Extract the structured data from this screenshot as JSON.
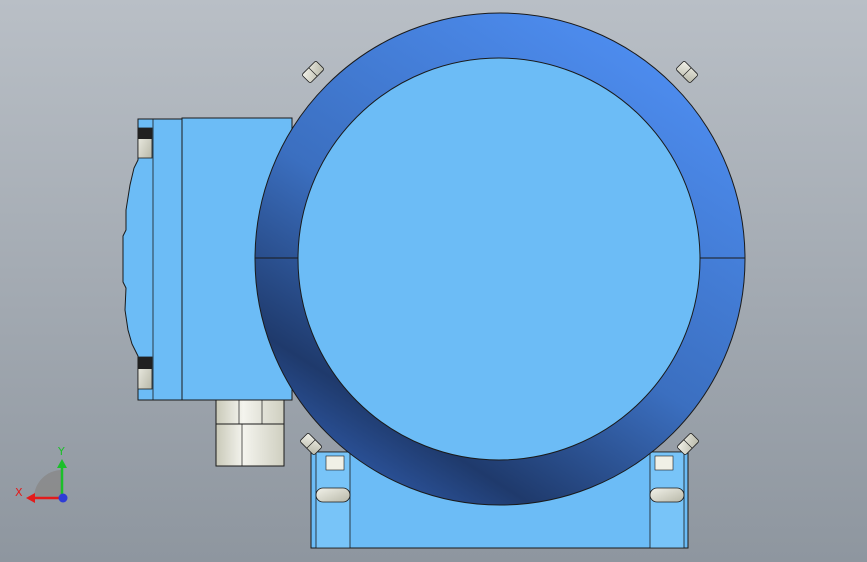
{
  "viewport": {
    "background_top": "#b9bfc6",
    "background_bottom": "#8e969f"
  },
  "part": {
    "body_color": "#6cbcf6",
    "body_color_dark": "#5aa7e4",
    "ring_light": "#4f8ff3",
    "ring_mid": "#3b6fc0",
    "ring_dark": "#1f3a6c",
    "outline_color": "#1a1a1a",
    "metal_light": "#f4f4ee",
    "metal_shade": "#c9c9b8",
    "bolt_dark": "#202020"
  },
  "triad": {
    "x_label": "X",
    "y_label": "Y",
    "x_color": "#e31b1b",
    "y_color": "#1bbf2a",
    "z_color": "#2e3cd6",
    "origin_color": "#8a8a8a"
  }
}
